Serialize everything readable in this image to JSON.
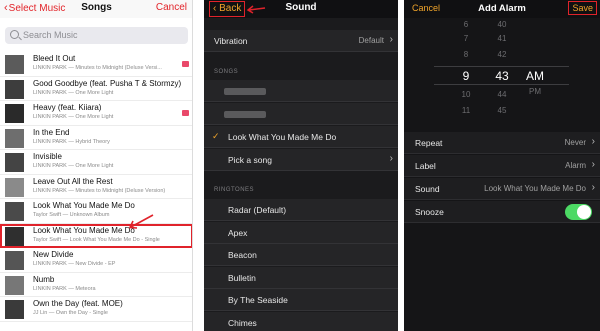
{
  "songs_screen": {
    "back_label": "Select Music",
    "title": "Songs",
    "cancel_label": "Cancel",
    "search_placeholder": "Search Music",
    "songs": [
      {
        "title": "Bleed It Out",
        "subtitle": "LINKIN PARK — Minutes to Midnight (Deluxe Versi...",
        "badge": true
      },
      {
        "title": "Good Goodbye (feat. Pusha T & Stormzy)",
        "subtitle": "LINKIN PARK — One More Light",
        "badge": false
      },
      {
        "title": "Heavy (feat. Kiiara)",
        "subtitle": "LINKIN PARK — One More Light",
        "badge": true
      },
      {
        "title": "In the End",
        "subtitle": "LINKIN PARK — Hybrid Theory",
        "badge": false
      },
      {
        "title": "Invisible",
        "subtitle": "LINKIN PARK — One More Light",
        "badge": false
      },
      {
        "title": "Leave Out All the Rest",
        "subtitle": "LINKIN PARK — Minutes to Midnight (Deluxe Version)",
        "badge": false
      },
      {
        "title": "Look What You Made Me Do",
        "subtitle": "Taylor Swift — Unknown Album",
        "badge": false
      },
      {
        "title": "Look What You Made Me Do",
        "subtitle": "Taylor Swift — Look What You Made Me Do - Single",
        "badge": false
      },
      {
        "title": "New Divide",
        "subtitle": "LINKIN PARK — New Divide - EP",
        "badge": false
      },
      {
        "title": "Numb",
        "subtitle": "LINKIN PARK — Meteora",
        "badge": false
      },
      {
        "title": "Own the Day (feat. MOE)",
        "subtitle": "JJ Lin — Own the Day - Single",
        "badge": false
      }
    ],
    "highlighted_index": 7,
    "accent_color": "#e2242a"
  },
  "sound_screen": {
    "back_label": "Back",
    "title": "Sound",
    "vibration_label": "Vibration",
    "vibration_value": "Default",
    "songs_section_label": "SONGS",
    "selected_song": "Look What You Made Me Do",
    "pick_song_label": "Pick a song",
    "ringtones_section_label": "RINGTONES",
    "ringtones": [
      "Radar (Default)",
      "Apex",
      "Beacon",
      "Bulletin",
      "By The Seaside",
      "Chimes"
    ],
    "accent_color": "#f0a42a"
  },
  "alarm_screen": {
    "cancel_label": "Cancel",
    "title": "Add Alarm",
    "save_label": "Save",
    "picker": {
      "hours": [
        "7",
        "8",
        "9",
        "10",
        "11"
      ],
      "minutes": [
        "41",
        "42",
        "43",
        "44",
        "45"
      ],
      "periods": [
        "AM",
        "PM"
      ],
      "selected_hour": "9",
      "selected_minute": "43",
      "selected_period": "AM",
      "top_partial": {
        "hour": "6",
        "minute": "40"
      }
    },
    "repeat_label": "Repeat",
    "repeat_value": "Never",
    "label_label": "Label",
    "label_value": "Alarm",
    "sound_label": "Sound",
    "sound_value": "Look What You Made Me Do",
    "snooze_label": "Snooze",
    "snooze_on": true,
    "toggle_color": "#4cd964"
  }
}
